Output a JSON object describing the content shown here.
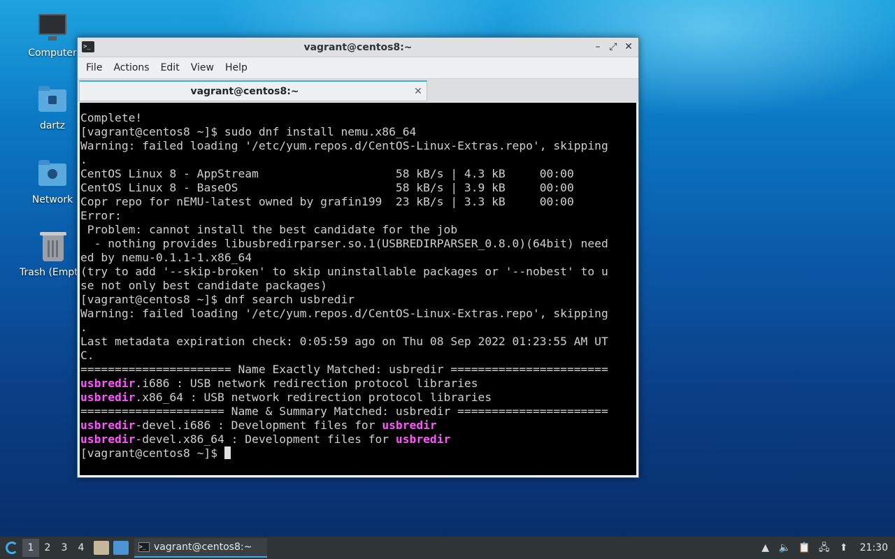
{
  "desktop": {
    "icons": [
      {
        "label": "Computer",
        "icon": "computer-icon"
      },
      {
        "label": "dartz",
        "icon": "home-folder-icon"
      },
      {
        "label": "Network",
        "icon": "network-folder-icon"
      },
      {
        "label": "Trash (Empty)",
        "icon": "trash-icon"
      }
    ]
  },
  "window": {
    "title": "vagrant@centos8:~",
    "menu": [
      "File",
      "Actions",
      "Edit",
      "View",
      "Help"
    ],
    "tab_title": "vagrant@centos8:~",
    "controls": {
      "minimize": "–",
      "maximize": "⤢",
      "close": "✕"
    },
    "tab_close": "✕"
  },
  "terminal": {
    "lines": [
      "Complete!",
      "[vagrant@centos8 ~]$ sudo dnf install nemu.x86_64",
      "Warning: failed loading '/etc/yum.repos.d/CentOS-Linux-Extras.repo', skipping",
      ".",
      "CentOS Linux 8 - AppStream                    58 kB/s | 4.3 kB     00:00",
      "CentOS Linux 8 - BaseOS                       58 kB/s | 3.9 kB     00:00",
      "Copr repo for nEMU-latest owned by grafin199  23 kB/s | 3.3 kB     00:00",
      "Error:",
      " Problem: cannot install the best candidate for the job",
      "  - nothing provides libusbredirparser.so.1(USBREDIRPARSER_0.8.0)(64bit) need",
      "ed by nemu-0.1.1-1.x86_64",
      "(try to add '--skip-broken' to skip uninstallable packages or '--nobest' to u",
      "se not only best candidate packages)",
      "[vagrant@centos8 ~]$ dnf search usbredir",
      "Warning: failed loading '/etc/yum.repos.d/CentOS-Linux-Extras.repo', skipping",
      ".",
      "Last metadata expiration check: 0:05:59 ago on Thu 08 Sep 2022 01:23:55 AM UT",
      "C.",
      "====================== Name Exactly Matched: usbredir ======================="
    ],
    "matches": [
      {
        "pre": "",
        "hl": "usbredir",
        "post": ".i686 : USB network redirection protocol libraries",
        "hl2": ""
      },
      {
        "pre": "",
        "hl": "usbredir",
        "post": ".x86_64 : USB network redirection protocol libraries",
        "hl2": ""
      }
    ],
    "separator2": "===================== Name & Summary Matched: usbredir ======================",
    "matches2": [
      {
        "hl": "usbredir",
        "post": "-devel.i686 : Development files for ",
        "hl2": "usbredir"
      },
      {
        "hl": "usbredir",
        "post": "-devel.x86_64 : Development files for ",
        "hl2": "usbredir"
      }
    ],
    "prompt": "[vagrant@centos8 ~]$ ",
    "highlight_color": "#ff54ff"
  },
  "taskbar": {
    "workspaces": [
      "1",
      "2",
      "3",
      "4"
    ],
    "active_workspace": "1",
    "task_label": "vagrant@centos8:~",
    "clock": "21:30",
    "tray_icons": [
      "upload-icon",
      "volume-icon",
      "clipboard-icon",
      "network-icon",
      "update-icon"
    ]
  }
}
